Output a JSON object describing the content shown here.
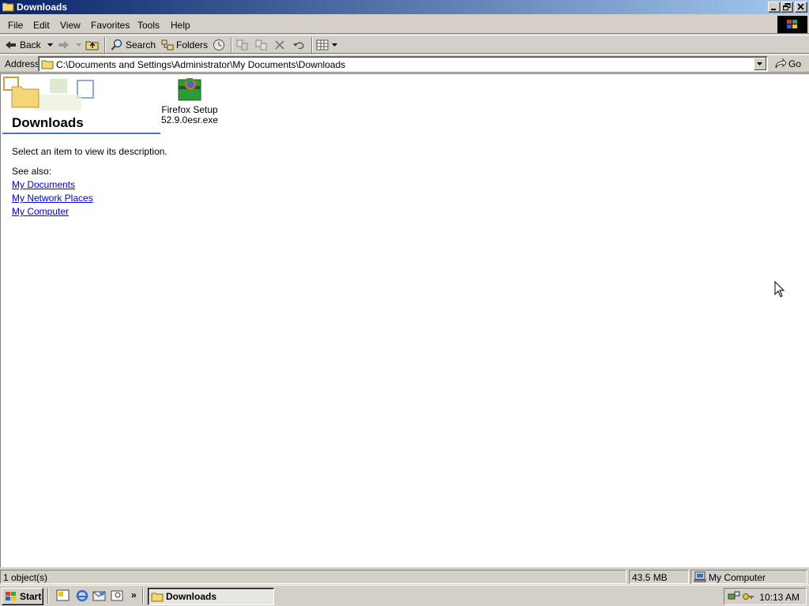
{
  "window": {
    "title": "Downloads",
    "min_icon": "minimize-icon",
    "max_icon": "restore-icon",
    "close_icon": "close-icon"
  },
  "menu": {
    "items": [
      "File",
      "Edit",
      "View",
      "Favorites",
      "Tools",
      "Help"
    ]
  },
  "toolbar": {
    "back_label": "Back",
    "search_label": "Search",
    "folders_label": "Folders"
  },
  "address": {
    "label": "Address",
    "value": "C:\\Documents and Settings\\Administrator\\My Documents\\Downloads",
    "go_label": "Go"
  },
  "webview": {
    "folder_title": "Downloads",
    "description": "Select an item to view its description.",
    "see_also_label": "See also:",
    "links": [
      "My Documents",
      "My Network Places",
      "My Computer"
    ]
  },
  "files": [
    {
      "name_line1": "Firefox Setup",
      "name_line2": "52.9.0esr.exe",
      "icon": "installer-icon"
    }
  ],
  "statusbar": {
    "objects": "1 object(s)",
    "size": "43.5 MB",
    "zone": "My Computer"
  },
  "taskbar": {
    "start_label": "Start",
    "task_label": "Downloads",
    "clock": "10:13 AM"
  },
  "colors": {
    "titlebar_start": "#0a246a",
    "titlebar_end": "#a6caf0",
    "face": "#d4d0c8",
    "link": "#0000ee"
  }
}
